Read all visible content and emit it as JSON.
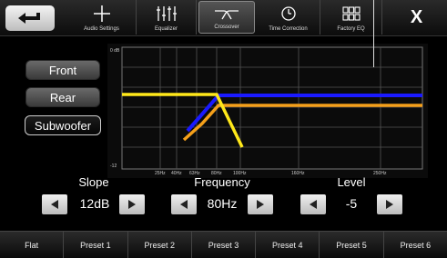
{
  "toolbar": {
    "back_icon": "back-arrow-icon",
    "tabs": [
      {
        "label": "Audio Settings",
        "icon": "plus-icon"
      },
      {
        "label": "Equalizer",
        "icon": "equalizer-sliders-icon"
      },
      {
        "label": "Crossover",
        "icon": "crossover-icon",
        "selected": true
      },
      {
        "label": "Time Correction",
        "icon": "clock-icon"
      },
      {
        "label": "Factory EQ",
        "icon": "grid-icon"
      }
    ],
    "close_label": "X"
  },
  "channels": [
    "Front",
    "Rear",
    "Subwoofer"
  ],
  "selected_channel": "Subwoofer",
  "graph": {
    "y_top_label": "0 dB",
    "y_bottom_label": "-12",
    "x_ticks": [
      "25Hz",
      "40Hz",
      "63Hz",
      "80Hz",
      "100Hz",
      "160Hz",
      "250Hz"
    ],
    "colors": {
      "front": "#1a1aff",
      "rear": "#f5a01a",
      "sub": "#ffe81a"
    }
  },
  "controls": {
    "slope": {
      "title": "Slope",
      "value": "12dB"
    },
    "frequency": {
      "title": "Frequency",
      "value": "80Hz"
    },
    "level": {
      "title": "Level",
      "value": "-5"
    }
  },
  "presets": [
    "Flat",
    "Preset 1",
    "Preset 2",
    "Preset 3",
    "Preset 4",
    "Preset 5",
    "Preset 6"
  ]
}
